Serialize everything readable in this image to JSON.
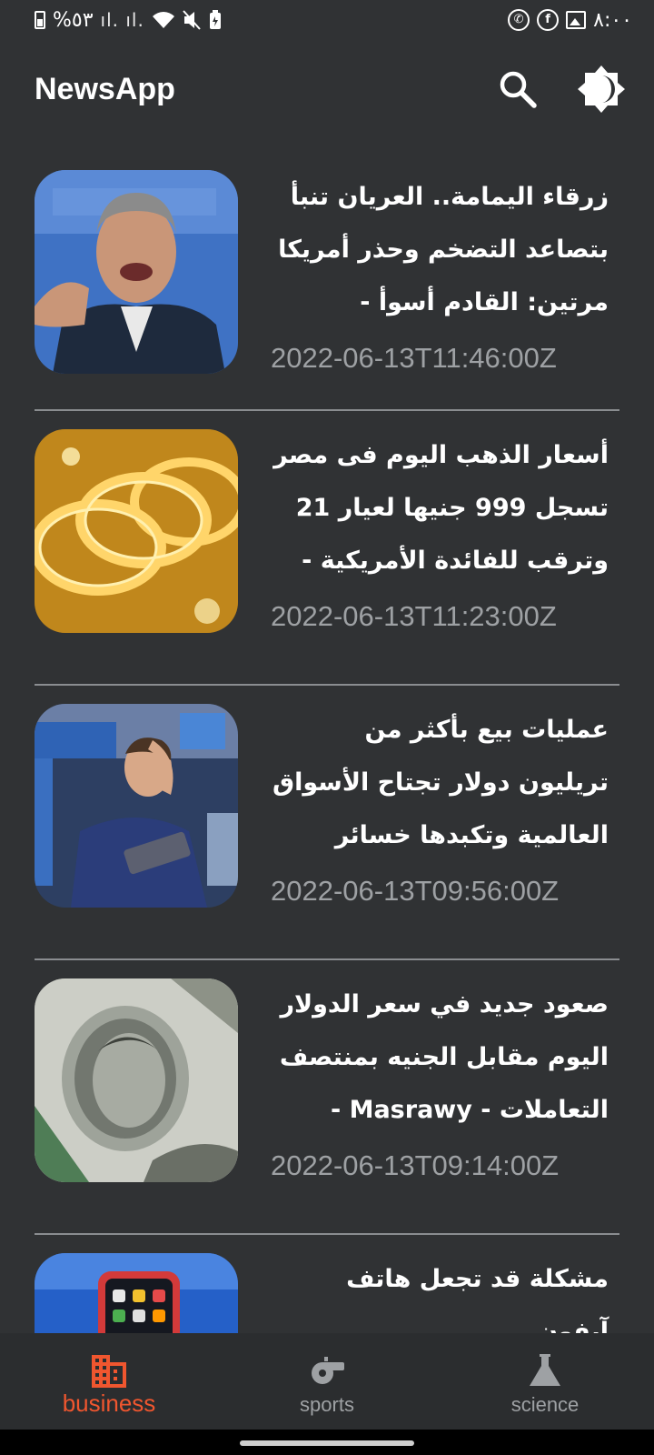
{
  "status_bar": {
    "battery_text": "%٥٣",
    "signal_text": "ıl. ıl.",
    "time": "٨:٠٠",
    "icons": [
      "battery-icon",
      "signal-icon",
      "wifi-icon",
      "mute-icon",
      "battery-saver-icon",
      "whatsapp-icon",
      "facebook-icon",
      "gallery-icon"
    ]
  },
  "app_bar": {
    "title": "NewsApp",
    "icons": [
      "search-icon",
      "theme-toggle-icon"
    ]
  },
  "articles": [
    {
      "title": "زرقاء اليمامة.. العريان تنبأ بتصاعد التضخم وحذر أمريكا مرتين: القادم أسوأ -",
      "date": "2022-06-13T11:46:00Z",
      "image": "man-speaking-photo"
    },
    {
      "title": "أسعار الذهب اليوم فى مصر تسجل 999 جنيها لعيار 21 وترقب للفائدة الأمريكية -",
      "date": "2022-06-13T11:23:00Z",
      "image": "gold-bangles-photo"
    },
    {
      "title": "عمليات بيع بأكثر من تريليون دولار تجتاح الأسواق العالمية وتكبدها خسائر قاسية -",
      "date": "2022-06-13T09:56:00Z",
      "image": "stock-trader-photo"
    },
    {
      "title": "صعود جديد في سعر الدولار اليوم مقابل الجنيه بمنتصف التعاملات - Masrawy -",
      "date": "2022-06-13T09:14:00Z",
      "image": "dollar-bill-photo"
    },
    {
      "title": "مشكلة قد تجعل هاتف آيفون",
      "date": "",
      "image": "iphone-photo"
    }
  ],
  "bottom_nav": {
    "items": [
      {
        "label": "business",
        "icon": "business-icon",
        "active": true
      },
      {
        "label": "sports",
        "icon": "whistle-icon",
        "active": false
      },
      {
        "label": "science",
        "icon": "flask-icon",
        "active": false
      }
    ],
    "active_color": "#f0562f",
    "inactive_color": "#9ea1a4"
  },
  "colors": {
    "background": "#303234",
    "divider": "#8a8d90",
    "date_text": "#9ea1a4"
  }
}
